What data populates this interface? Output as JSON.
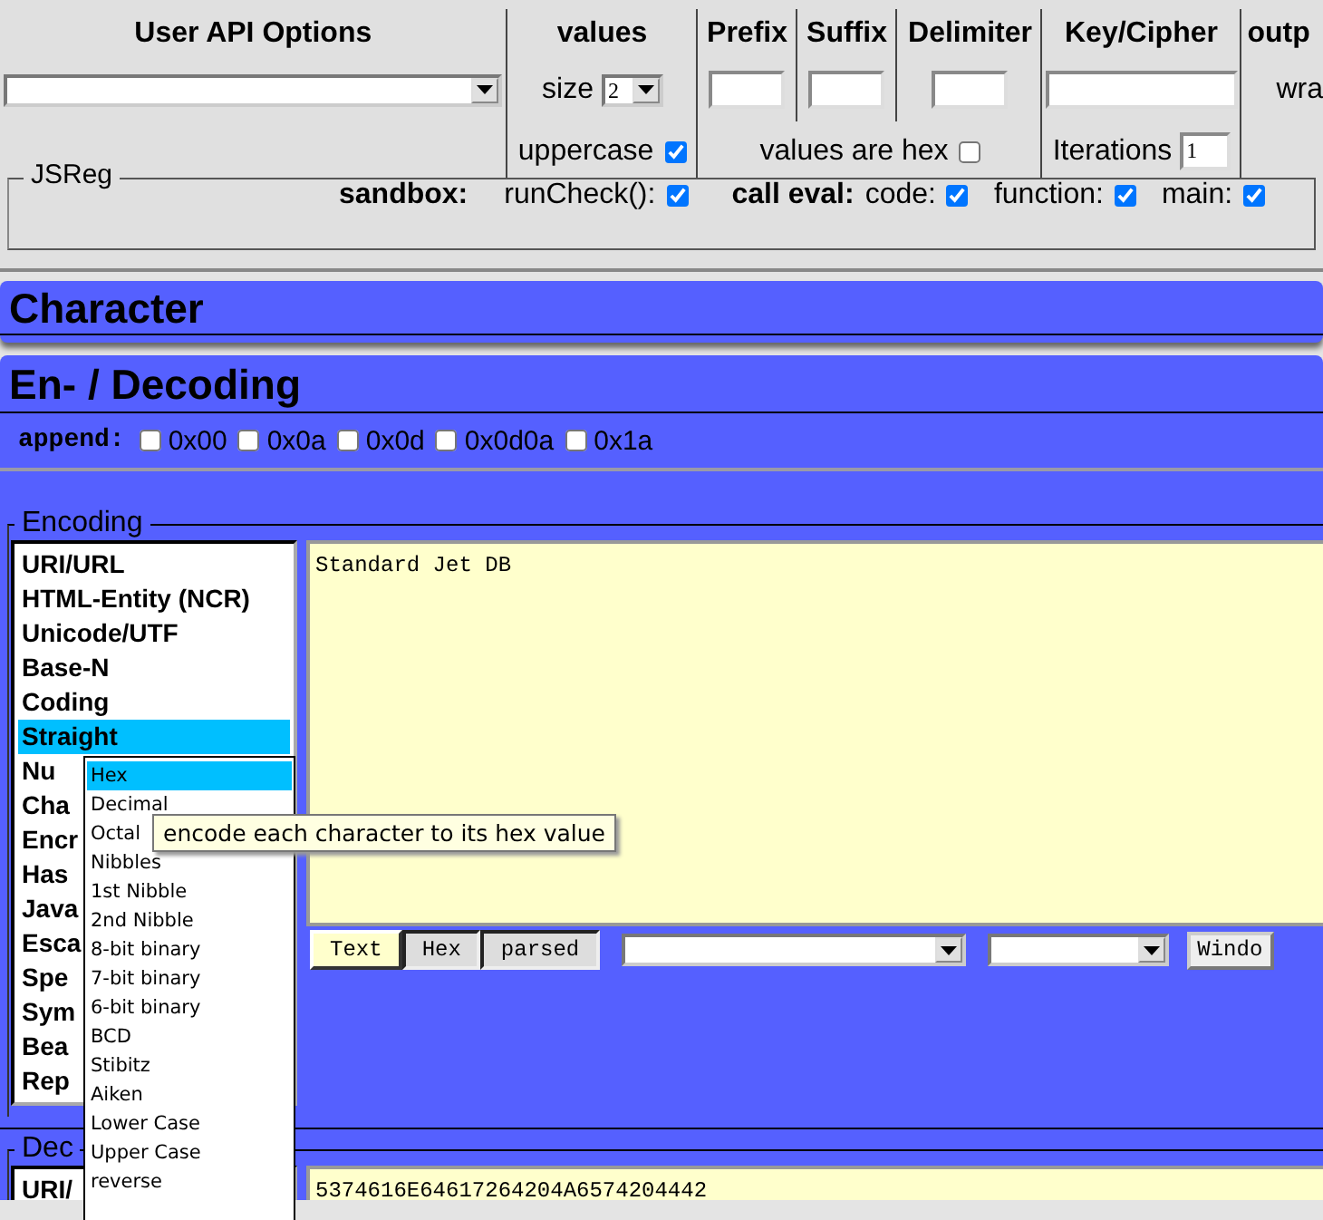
{
  "top_bar": {
    "api_options": {
      "title": "User API Options"
    },
    "values": {
      "title": "values",
      "size_label": "size",
      "size": "2",
      "uppercase_label": "uppercase",
      "uppercase": true
    },
    "affixes": [
      {
        "title": "Prefix"
      },
      {
        "title": "Suffix"
      },
      {
        "title": "Delimiter"
      }
    ],
    "hex_option": {
      "label": "values are hex",
      "checked": false
    },
    "key_cipher": {
      "title": "Key/Cipher",
      "iterations_label": "Iterations",
      "iterations": "1"
    },
    "output": {
      "title": "outp",
      "wrap_label": "wra"
    }
  },
  "jsreg": {
    "legend": "JSReg",
    "groups": [
      {
        "label": "sandbox:",
        "options": [
          {
            "label": "runCheck():",
            "checked": true
          }
        ]
      },
      {
        "label": "call eval:",
        "options": [
          {
            "label": "code:",
            "checked": true
          },
          {
            "label": "function:",
            "checked": true
          },
          {
            "label": "main:",
            "checked": true
          }
        ]
      }
    ]
  },
  "character_bar": {
    "title": "Character"
  },
  "decoding_bar": {
    "title": "En- / Decoding",
    "append_label": "append:",
    "append_options": [
      {
        "label": "0x00",
        "checked": false
      },
      {
        "label": "0x0a",
        "checked": false
      },
      {
        "label": "0x0d",
        "checked": false
      },
      {
        "label": "0x0d0a",
        "checked": false
      },
      {
        "label": "0x1a",
        "checked": false
      }
    ]
  },
  "encoding": {
    "legend": "Encoding",
    "categories": [
      {
        "label": "URI/URL",
        "selected": false
      },
      {
        "label": "HTML-Entity (NCR)",
        "selected": false
      },
      {
        "label": "Unicode/UTF",
        "selected": false
      },
      {
        "label": "Base-N",
        "selected": false
      },
      {
        "label": "Coding",
        "selected": false
      },
      {
        "label": "Straight",
        "selected": true
      },
      {
        "label": "Nu",
        "selected": false
      },
      {
        "label": "Cha",
        "selected": false
      },
      {
        "label": "Encr",
        "selected": false
      },
      {
        "label": "Has",
        "selected": false
      },
      {
        "label": "Java",
        "selected": false
      },
      {
        "label": "Esca",
        "selected": false
      },
      {
        "label": "Spe",
        "selected": false
      },
      {
        "label": "Sym",
        "selected": false
      },
      {
        "label": "Bea",
        "selected": false
      },
      {
        "label": "Rep",
        "selected": false
      }
    ],
    "text": "Standard Jet DB",
    "view_tabs": [
      {
        "label": "Text",
        "selected": true
      },
      {
        "label": "Hex",
        "selected": false
      },
      {
        "label": "parsed",
        "selected": false
      }
    ],
    "button": "Windo"
  },
  "decoding": {
    "legend": "Dec",
    "categories": [
      {
        "label": "URI/",
        "selected": false
      }
    ],
    "text": "5374616E64617264204A6574204442"
  },
  "submenu": {
    "items": [
      {
        "label": "Hex",
        "selected": true
      },
      {
        "label": "Decimal",
        "selected": false
      },
      {
        "label": "Octal",
        "selected": false
      },
      {
        "label": "Nibbles",
        "selected": false
      },
      {
        "label": "1st Nibble",
        "selected": false
      },
      {
        "label": "2nd Nibble",
        "selected": false
      },
      {
        "label": "8-bit binary",
        "selected": false
      },
      {
        "label": "7-bit binary",
        "selected": false
      },
      {
        "label": "6-bit binary",
        "selected": false
      },
      {
        "label": "BCD",
        "selected": false
      },
      {
        "label": "Stibitz",
        "selected": false
      },
      {
        "label": "Aiken",
        "selected": false
      },
      {
        "label": "Lower Case",
        "selected": false
      },
      {
        "label": "Upper Case",
        "selected": false
      },
      {
        "label": "reverse",
        "selected": false
      }
    ]
  },
  "tooltip": "encode each character to its hex value"
}
